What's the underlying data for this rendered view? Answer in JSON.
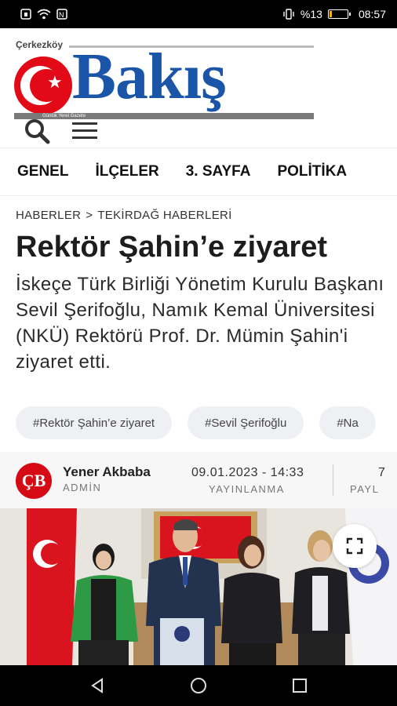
{
  "status_bar": {
    "left_icons": [
      "sim-icon",
      "wifi-icon",
      "nfc-icon"
    ],
    "right_icons": [
      "vibrate-icon"
    ],
    "battery_text": "%13",
    "battery_level": 0.13,
    "time": "08:57"
  },
  "header": {
    "logo_small": "Çerkezköy",
    "logo_brand": "Bakış",
    "tagline": "Günlük Yerel Gazete",
    "brand_color": "#1a55a8",
    "accent_color": "#e30a17",
    "search_icon": "search-icon",
    "menu_icon": "menu-icon"
  },
  "nav": {
    "items": [
      "GENEL",
      "İLÇELER",
      "3. SAYFA",
      "POLİTİKA"
    ]
  },
  "article": {
    "breadcrumb": [
      "HABERLER",
      ">",
      "TEKİRDAĞ HABERLERİ"
    ],
    "title": "Rektör Şahin’e ziyaret",
    "summary": "İskeçe Türk Birliği Yönetim Kurulu Başkanı Sevil Şerifoğlu, Namık Kemal Üniversitesi (NKÜ) Rektörü Prof. Dr. Mümin Şahin'i ziyaret etti.",
    "tags": [
      "#Rektör Şahin’e ziyaret",
      "#Sevil Şerifoğlu",
      "#Na"
    ]
  },
  "author": {
    "avatar_text": "ÇB",
    "name": "Yener Akbaba",
    "role": "ADMİN",
    "date": "09.01.2023 - 14:33",
    "date_label": "YAYINLANMA",
    "share_top": "7",
    "share_label": "PAYL"
  },
  "photo": {
    "fullscreen_icon": "expand-icon"
  }
}
